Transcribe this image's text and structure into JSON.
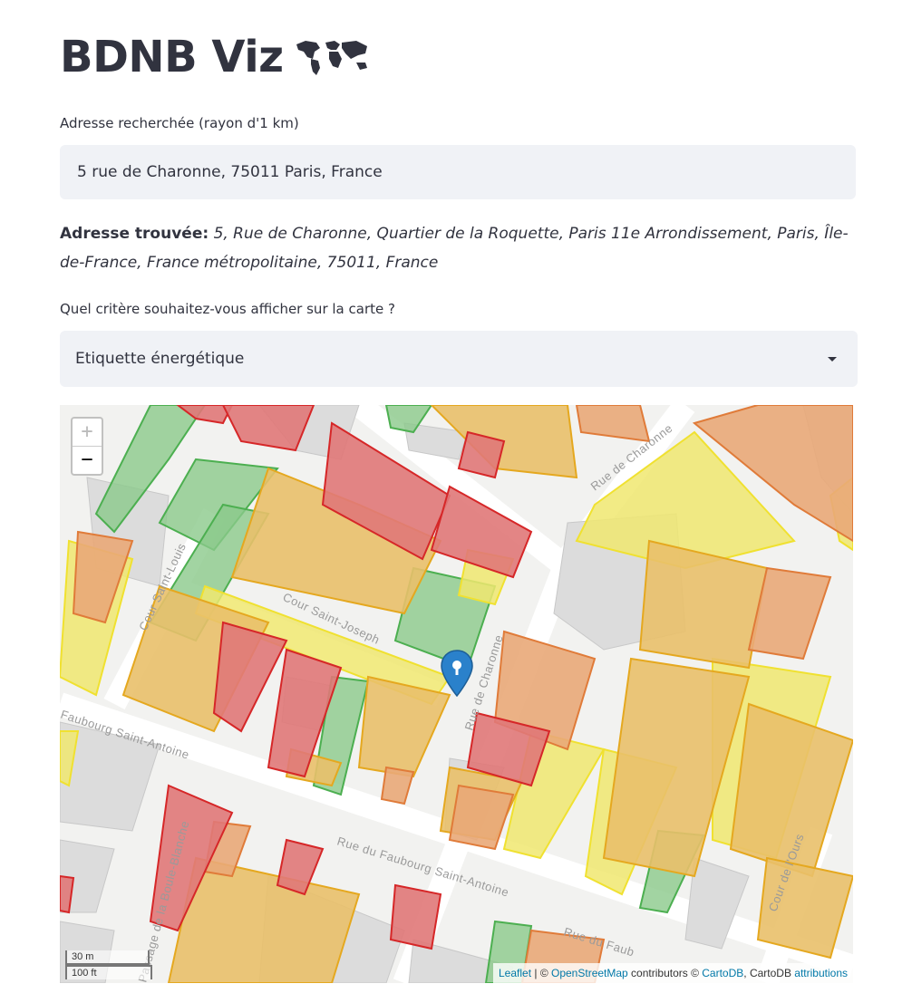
{
  "app": {
    "title": "BDNB Viz",
    "title_icon": "world-map-icon"
  },
  "search": {
    "label": "Adresse recherchée (rayon d'1 km)",
    "value": "5 rue de Charonne, 75011 Paris, France"
  },
  "result": {
    "prefix": "Adresse trouvée:",
    "address": "5, Rue de Charonne, Quartier de la Roquette, Paris 11e Arrondissement, Paris, Île-de-France, France métropolitaine, 75011, France"
  },
  "criterion": {
    "label": "Quel critère souhaitez-vous afficher sur la carte ?",
    "selected": "Etiquette énergétique"
  },
  "map": {
    "zoom_in": "+",
    "zoom_out": "−",
    "scale_metric": "30 m",
    "scale_imperial": "100 ft",
    "streets": {
      "charonne_top": "Rue de Charonne",
      "charonne_mid": "Rue de Charonne",
      "cour_saint_joseph": "Cour Saint-Joseph",
      "cour_saint_louis": "Cour Saint-Louis",
      "faubourg_top": "Faubourg Saint-Antoine",
      "faubourg_main": "Rue du Faubourg Saint-Antoine",
      "faubourg_end": "Rue du Faub",
      "boule_blanche": "Passage de la Boule-Blanche",
      "cour_ours": "Cour de l'Ours"
    },
    "attribution": {
      "leaflet": "Leaflet",
      "sep1": " | © ",
      "osm": "OpenStreetMap",
      "mid": " contributors © ",
      "cartodb": "CartoDB",
      "sep2": ", CartoDB ",
      "attributions": "attributions"
    },
    "colors": {
      "red": "#d62728",
      "orange": "#e07b39",
      "amber": "#e5a81f",
      "yellow": "#f0e130",
      "green": "#4caf50"
    }
  }
}
